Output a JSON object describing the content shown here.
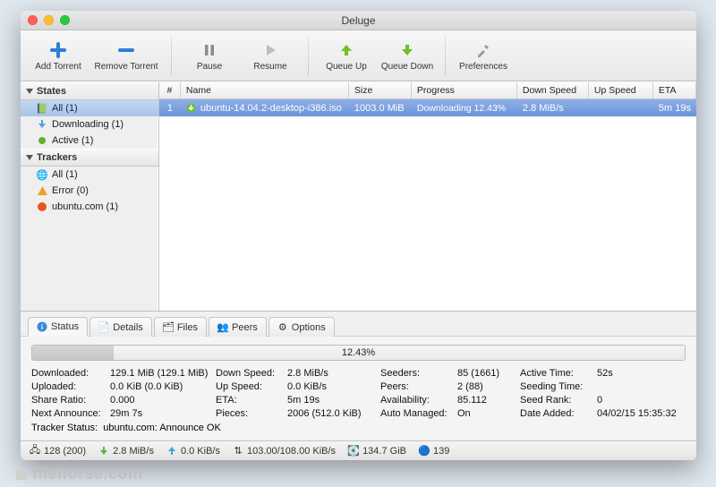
{
  "window": {
    "title": "Deluge"
  },
  "toolbar": {
    "add": "Add Torrent",
    "remove": "Remove Torrent",
    "pause": "Pause",
    "resume": "Resume",
    "up": "Queue Up",
    "down": "Queue Down",
    "prefs": "Preferences"
  },
  "sidebar": {
    "states_head": "States",
    "states": [
      {
        "label": "All (1)"
      },
      {
        "label": "Downloading (1)"
      },
      {
        "label": "Active (1)"
      }
    ],
    "trackers_head": "Trackers",
    "trackers": [
      {
        "label": "All (1)"
      },
      {
        "label": "Error (0)"
      },
      {
        "label": "ubuntu.com (1)"
      }
    ]
  },
  "columns": {
    "num": "#",
    "name": "Name",
    "size": "Size",
    "progress": "Progress",
    "down": "Down Speed",
    "up": "Up Speed",
    "eta": "ETA"
  },
  "row": {
    "num": "1",
    "name": "ubuntu-14.04.2-desktop-i386.iso",
    "size": "1003.0 MiB",
    "progress_label": "Downloading 12.43%",
    "down": "2.8 MiB/s",
    "up": "",
    "eta": "5m 19s"
  },
  "tabs": {
    "status": "Status",
    "details": "Details",
    "files": "Files",
    "peers": "Peers",
    "options": "Options"
  },
  "panel": {
    "pct": "12.43%",
    "rows": {
      "downloaded_l": "Downloaded:",
      "downloaded_v": "129.1 MiB (129.1 MiB)",
      "uploaded_l": "Uploaded:",
      "uploaded_v": "0.0 KiB (0.0 KiB)",
      "share_l": "Share Ratio:",
      "share_v": "0.000",
      "next_l": "Next Announce:",
      "next_v": "29m 7s",
      "ds_l": "Down Speed:",
      "ds_v": "2.8 MiB/s",
      "us_l": "Up Speed:",
      "us_v": "0.0 KiB/s",
      "eta_l": "ETA:",
      "eta_v": "5m 19s",
      "pieces_l": "Pieces:",
      "pieces_v": "2006 (512.0 KiB)",
      "seeders_l": "Seeders:",
      "seeders_v": "85 (1661)",
      "peers_l": "Peers:",
      "peers_v": "2 (88)",
      "avail_l": "Availability:",
      "avail_v": "85.112",
      "auto_l": "Auto Managed:",
      "auto_v": "On",
      "active_l": "Active Time:",
      "active_v": "52s",
      "seeding_l": "Seeding Time:",
      "seeding_v": "",
      "rank_l": "Seed Rank:",
      "rank_v": "0",
      "added_l": "Date Added:",
      "added_v": "04/02/15 15:35:32"
    },
    "tracker_l": "Tracker Status:",
    "tracker_v": "ubuntu.com: Announce OK"
  },
  "statusbar": {
    "conns": "128 (200)",
    "down": "2.8 MiB/s",
    "up": "0.0 KiB/s",
    "ratio": "103.00/108.00 KiB/s",
    "free": "134.7 GiB",
    "dht": "139"
  },
  "watermark": "filehorse.com"
}
